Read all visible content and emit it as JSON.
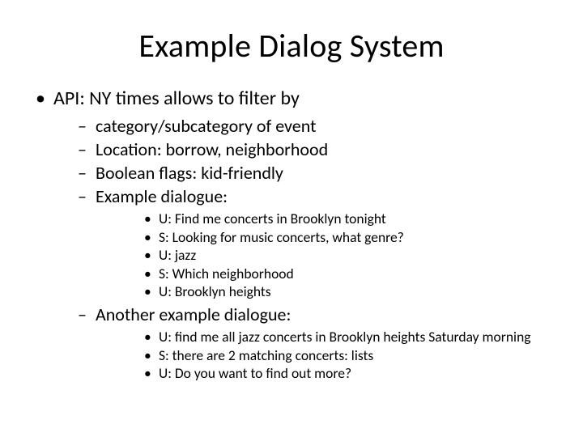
{
  "title": "Example Dialog System",
  "lvl1": {
    "item0": "API: NY times allows to filter by",
    "sub": {
      "item0": "category/subcategory of event",
      "item1": "Location: borrow, neighborhood",
      "item2": "Boolean flags: kid-friendly",
      "item3": "Example dialogue:",
      "dialogue1": {
        "d0": "U: Find me concerts in Brooklyn tonight",
        "d1": "S:  Looking for music concerts, what genre?",
        "d2": "U: jazz",
        "d3": "S: Which neighborhood",
        "d4": "U: Brooklyn heights"
      },
      "item4": "Another example dialogue:",
      "dialogue2": {
        "d0": "U: find me all jazz concerts in Brooklyn heights Saturday morning",
        "d1": "S: there are 2 matching concerts: lists",
        "d2": "U: Do you want to find out more?"
      }
    }
  }
}
